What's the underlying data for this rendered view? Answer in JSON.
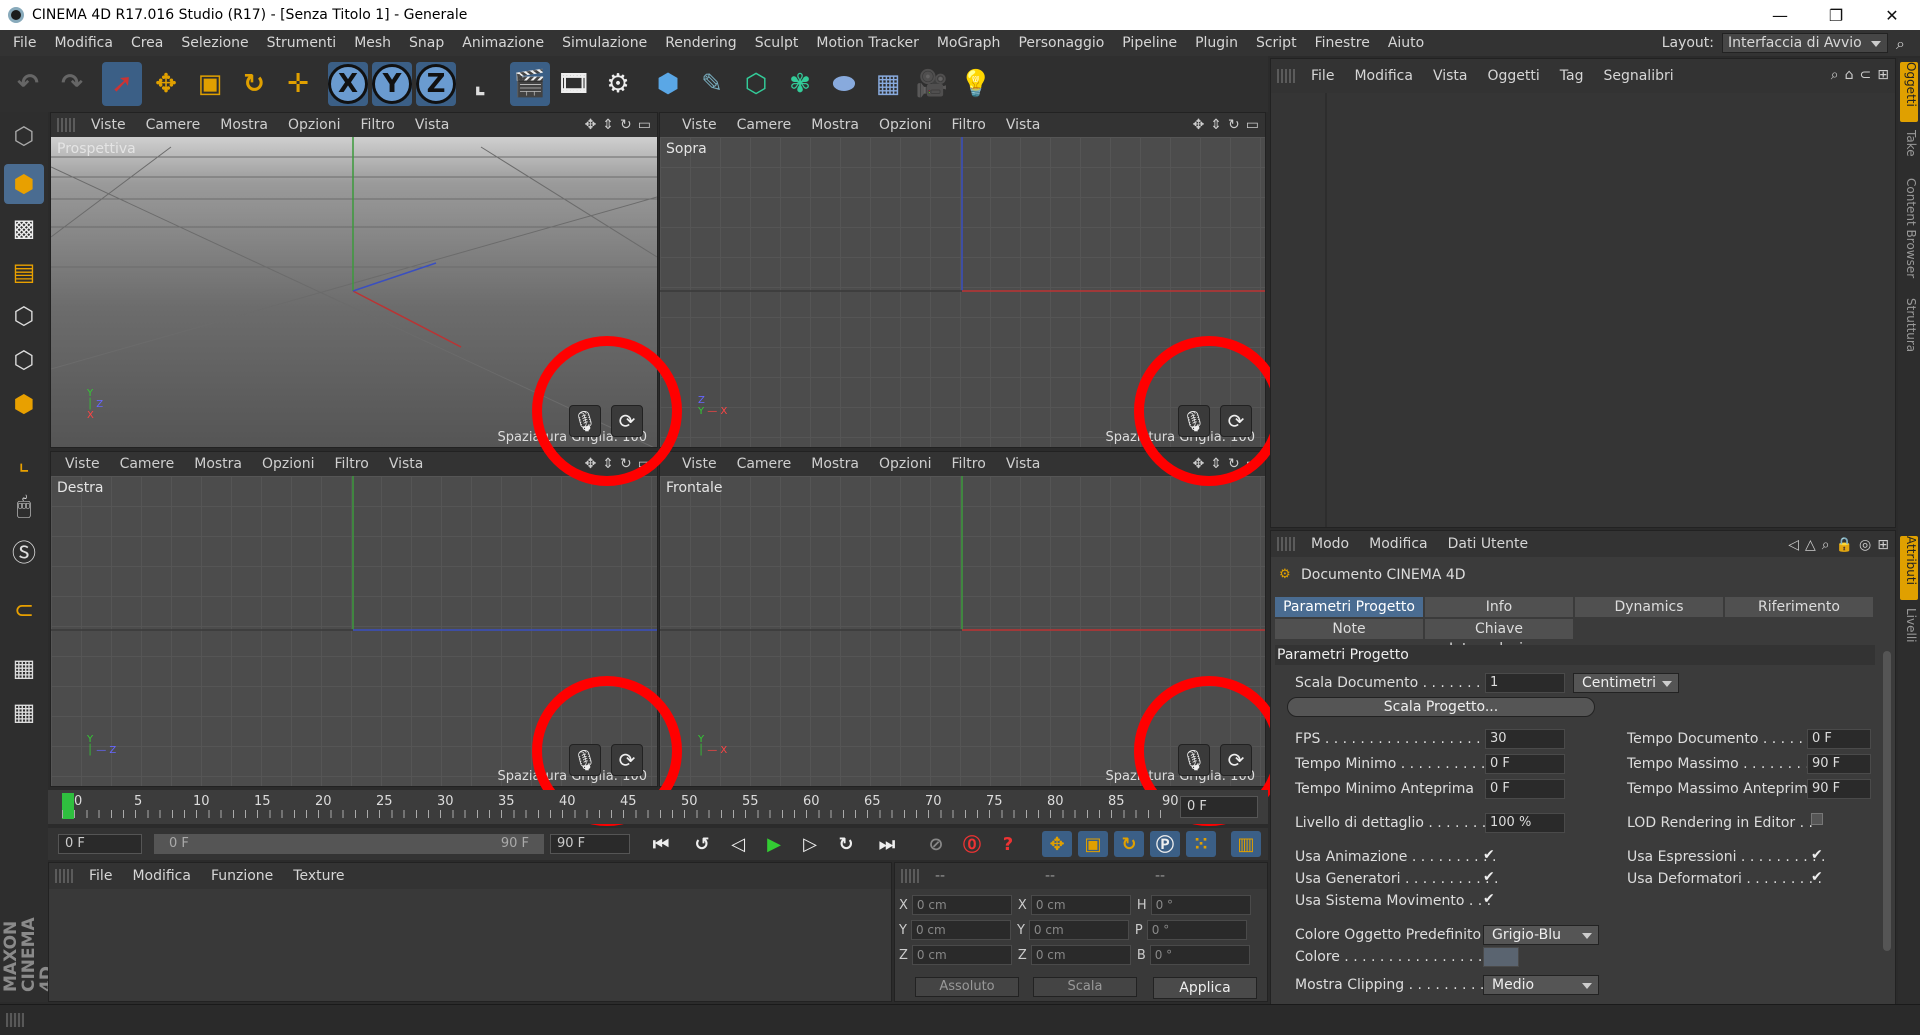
{
  "window": {
    "title": "CINEMA 4D R17.016 Studio (R17) - [Senza Titolo 1] - Generale",
    "minimize": "—",
    "maximize": "❐",
    "close": "✕"
  },
  "menu": [
    "File",
    "Modifica",
    "Crea",
    "Selezione",
    "Strumenti",
    "Mesh",
    "Snap",
    "Animazione",
    "Simulazione",
    "Rendering",
    "Sculpt",
    "Motion Tracker",
    "MoGraph",
    "Personaggio",
    "Pipeline",
    "Plugin",
    "Script",
    "Finestre",
    "Aiuto"
  ],
  "layout": {
    "label": "Layout:",
    "value": "Interfaccia di Avvio"
  },
  "toolbar": {
    "axis_x": "X",
    "axis_y": "Y",
    "axis_z": "Z"
  },
  "viewport_menu": [
    "Viste",
    "Camere",
    "Mostra",
    "Opzioni",
    "Filtro",
    "Vista"
  ],
  "viewports": [
    {
      "name": "Prospettiva",
      "spacing": "Spaziatura Griglia: 100"
    },
    {
      "name": "Sopra",
      "spacing": "Spaziatura Griglia: 100"
    },
    {
      "name": "Destra",
      "spacing": "Spaziatura Griglia: 100"
    },
    {
      "name": "Frontale",
      "spacing": "Spaziatura Griglia: 100"
    }
  ],
  "timeline": {
    "ticks": [
      "0",
      "5",
      "10",
      "15",
      "20",
      "25",
      "30",
      "35",
      "40",
      "45",
      "50",
      "55",
      "60",
      "65",
      "70",
      "75",
      "80",
      "85",
      "90"
    ],
    "current": "0 F"
  },
  "playback": {
    "start": "0 F",
    "range_start": "0 F",
    "range_end": "90 F",
    "end": "90 F"
  },
  "material_menu": [
    "File",
    "Modifica",
    "Funzione",
    "Texture"
  ],
  "coords": {
    "head": [
      "--",
      "--",
      "--"
    ],
    "rows": [
      {
        "a": "X",
        "av": "0 cm",
        "b": "X",
        "bv": "0 cm",
        "c": "H",
        "cv": "0 °"
      },
      {
        "a": "Y",
        "av": "0 cm",
        "b": "Y",
        "bv": "0 cm",
        "c": "P",
        "cv": "0 °"
      },
      {
        "a": "Z",
        "av": "0 cm",
        "b": "Z",
        "bv": "0 cm",
        "c": "B",
        "cv": "0 °"
      }
    ],
    "mode1": "Assoluto",
    "mode2": "Scala",
    "apply": "Applica"
  },
  "object_menu": [
    "File",
    "Modifica",
    "Vista",
    "Oggetti",
    "Tag",
    "Segnalibri"
  ],
  "side_tabs": [
    "Oggetti",
    "Take",
    "Content Browser",
    "Struttura",
    "Attributi",
    "Livelli"
  ],
  "attr": {
    "menu": [
      "Modo",
      "Modifica",
      "Dati Utente"
    ],
    "doc_title": "Documento CINEMA 4D",
    "tabs1": [
      "Parametri Progetto",
      "Info",
      "Dynamics",
      "Riferimento"
    ],
    "tabs2": [
      "Note",
      "Chiave Interpolazione"
    ],
    "section": "Parametri Progetto",
    "scala_documento": "Scala Documento . . . . . . . . .",
    "scala_val": "1",
    "unita": "Centimetri",
    "scala_progetto": "Scala Progetto...",
    "fps_label": "FPS . . . . . . . . . . . . . . . . . . . .",
    "fps": "30",
    "tempo_min_label": "Tempo Minimo . . . . . . . . . . .",
    "tempo_min": "0 F",
    "tempo_min_ant_label": "Tempo Minimo Anteprima",
    "tempo_min_ant": "0 F",
    "tempo_doc_label": "Tempo Documento . . . . . . . .",
    "tempo_doc": "0 F",
    "tempo_max_label": "Tempo Massimo . . . . . . . . . .",
    "tempo_max": "90 F",
    "tempo_max_ant_label": "Tempo Massimo Anteprima",
    "tempo_max_ant": "90 F",
    "lod_label": "Livello di dettaglio . . . . . . . .",
    "lod": "100 %",
    "lod_render_label": "LOD Rendering in Editor . .",
    "usa_anim": "Usa Animazione . . . . . . . . . .",
    "usa_gen": "Usa Generatori . . . . . . . . . . .",
    "usa_sist": "Usa Sistema Movimento . . .",
    "usa_espr": "Usa Espressioni . . . . . . . . . .",
    "usa_def": "Usa Deformatori . . . . . . . . .",
    "check": "✔",
    "colore_pred_label": "Colore Oggetto Predefinito",
    "colore_pred": "Grigio-Blu",
    "colore_label": "Colore . . . . . . . . . . . . . . . . .",
    "mostra_clip_label": "Mostra Clipping . . . . . . . . . .",
    "mostra_clip": "Medio"
  },
  "colors": {
    "accent": "#4a6c91",
    "highlight": "#ff0000",
    "playhead": "#2fbf3f"
  }
}
